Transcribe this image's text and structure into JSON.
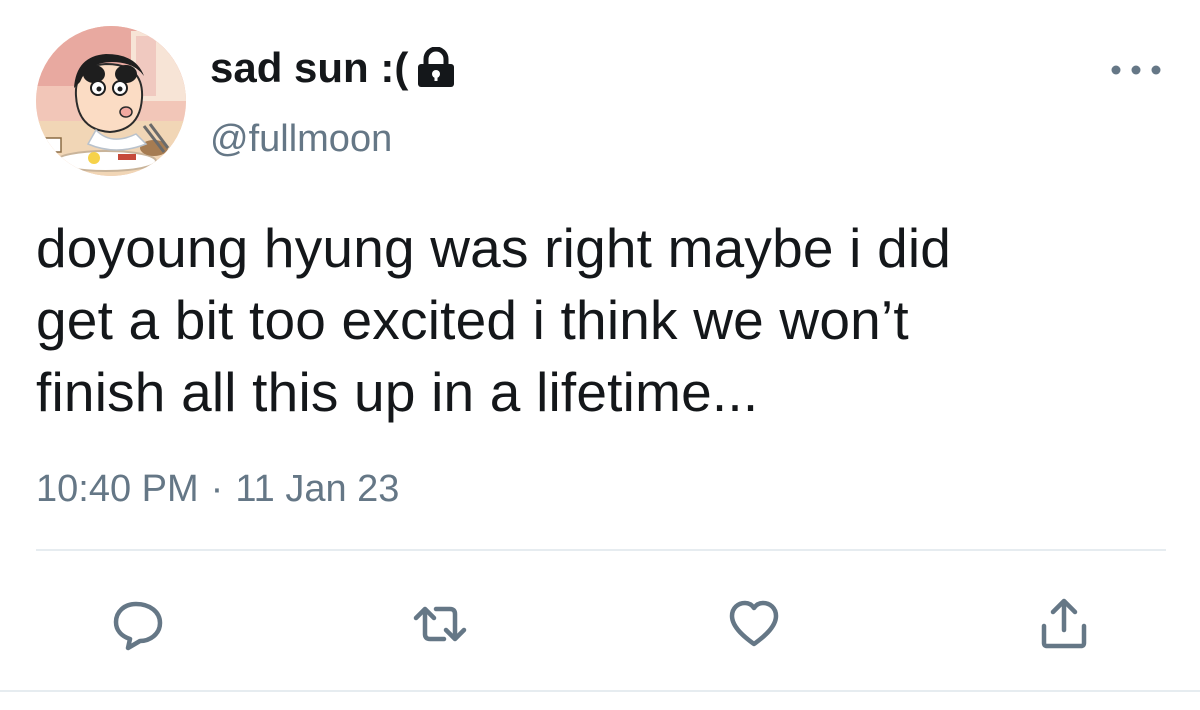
{
  "tweet": {
    "display_name": "sad sun :(",
    "handle": "@fullmoon",
    "text_lines": [
      "doyoung hyung was right maybe i did",
      "get a bit too excited i think we won’t",
      "finish all this up in a lifetime..."
    ],
    "time": "10:40 PM",
    "separator": "·",
    "date": "11 Jan 23"
  },
  "icons": {
    "lock": "lock-icon",
    "more": "more-options-icon",
    "reply": "reply-icon",
    "retweet": "retweet-icon",
    "like": "heart-icon",
    "share": "share-icon"
  },
  "colors": {
    "text": "#14171a",
    "secondary": "#657786",
    "divider": "#e6ecf0"
  }
}
